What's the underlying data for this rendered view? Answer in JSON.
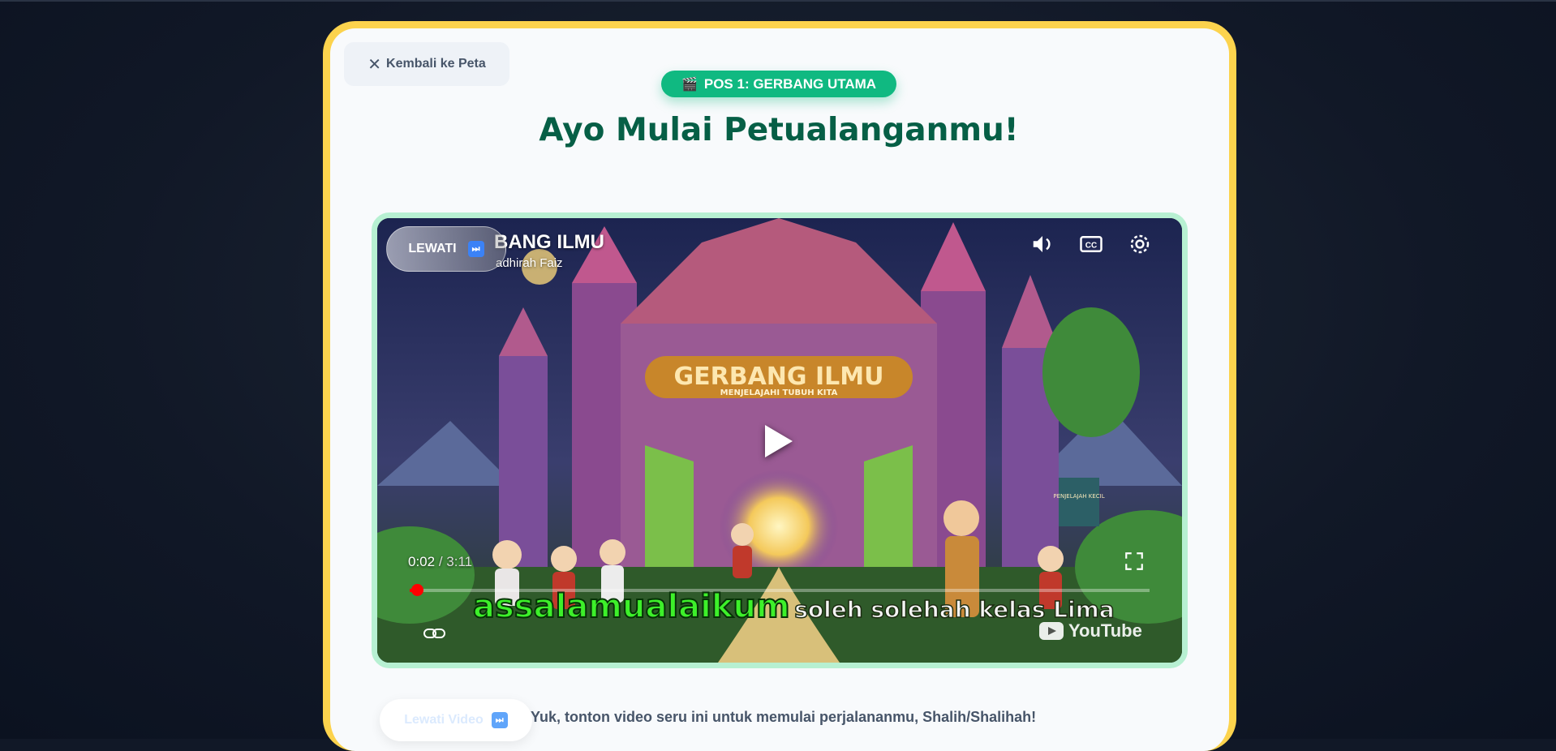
{
  "nav": {
    "back_label": "Kembali ke Peta"
  },
  "badge": {
    "label": "POS 1: GERBANG UTAMA",
    "icon": "clapperboard-icon"
  },
  "headline": "Ayo Mulai Petualanganmu!",
  "video": {
    "title": "BANG ILMU",
    "channel": "adhirah Faiz",
    "skip_label": "LEWATI",
    "current_time": "0:02",
    "separator": "/",
    "duration": "3:11",
    "progress": 0.01,
    "caption_highlight": "assalamualaikum",
    "caption_rest": "soleh solehah kelas Lima",
    "platform": "YouTube",
    "scene_sign_title": "GERBANG ILMU",
    "scene_sign_subtitle": "MENJELAJAHI TUBUH KITA",
    "scene_banner": "PENJELAJAH KECIL"
  },
  "footer": {
    "skip_video_label": "Lewati Video",
    "instruction": "Yuk, tonton video seru ini untuk memulai perjalananmu, Shalih/Shalihah!"
  },
  "colors": {
    "page_bg": "#111827",
    "card_border": "#fcd34d",
    "accent_green": "#10b981",
    "headline_green": "#065f46",
    "video_border": "#b7f0d2"
  }
}
